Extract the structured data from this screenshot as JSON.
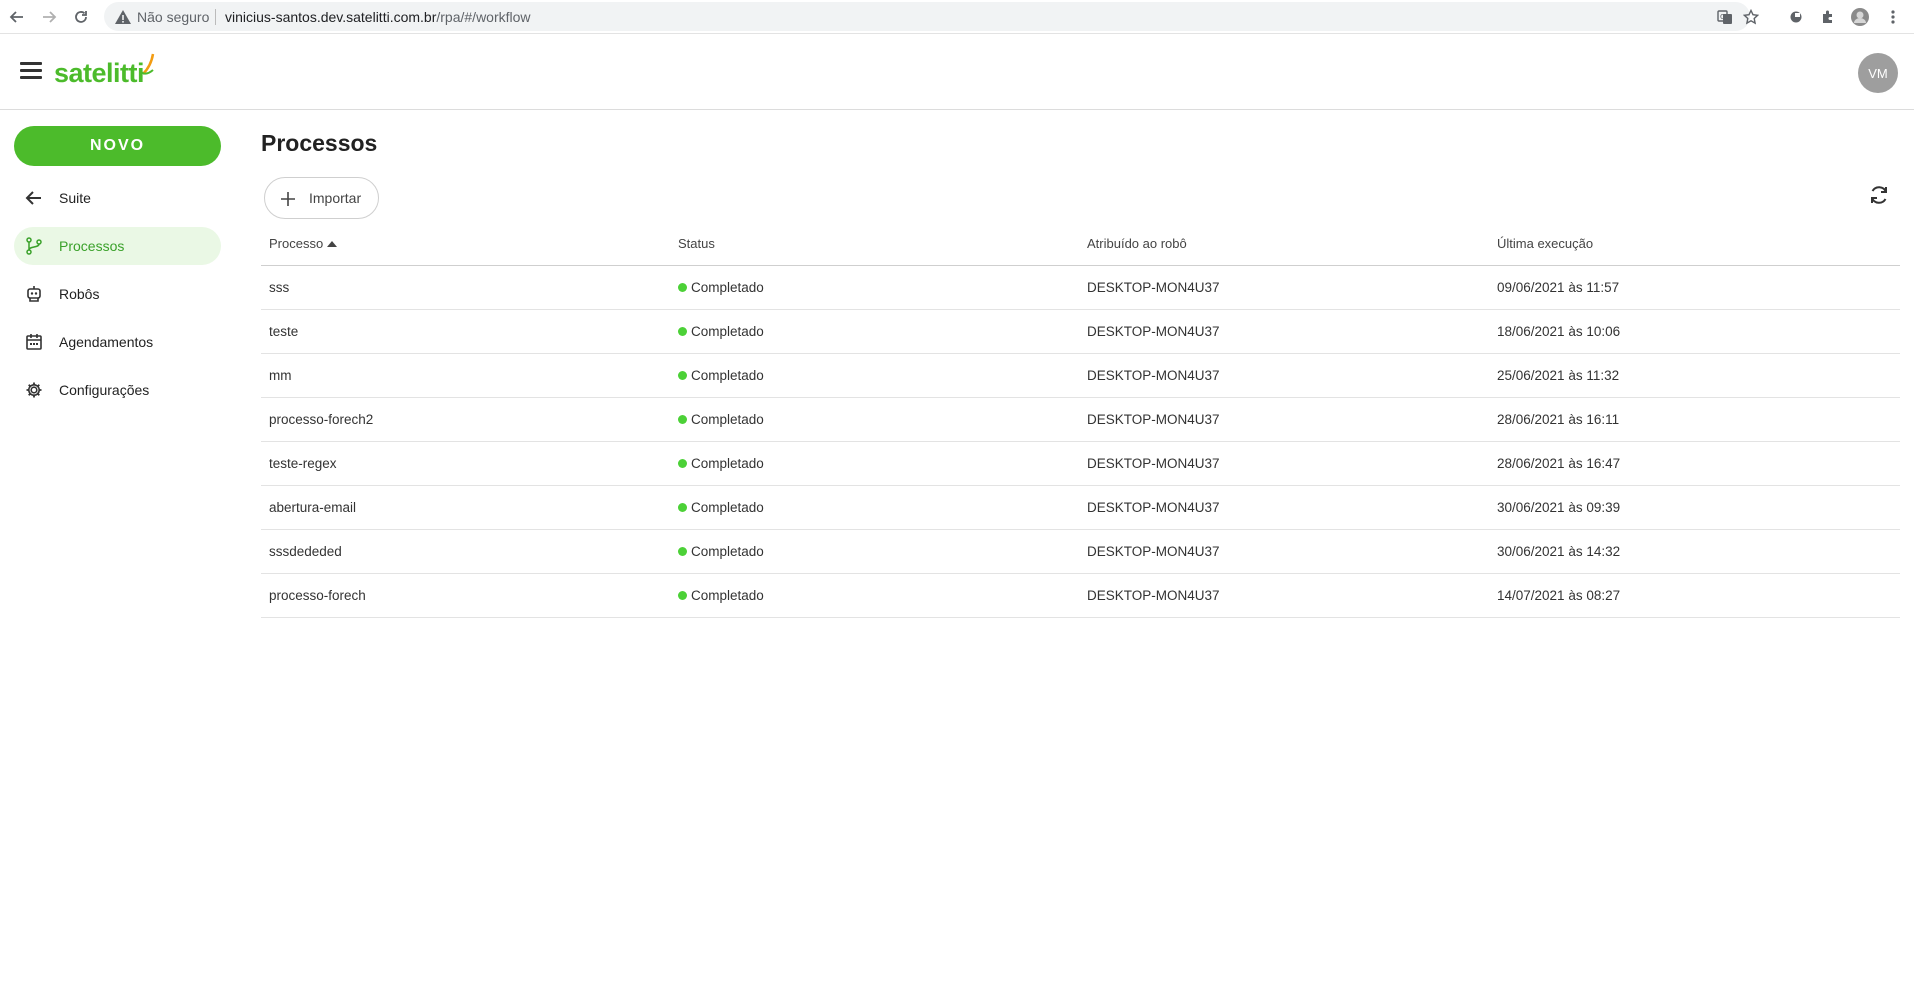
{
  "browser": {
    "security_label": "Não seguro",
    "url_host": "vinicius-santos.dev.satelitti.com.br",
    "url_path": "/rpa/#/workflow"
  },
  "header": {
    "logo_text": "satelitti",
    "avatar_initials": "VM",
    "brand_color": "#4cbb2b"
  },
  "sidebar": {
    "new_button": "NOVO",
    "items": [
      {
        "label": "Suite",
        "icon": "arrow-left-icon",
        "active": false
      },
      {
        "label": "Processos",
        "icon": "flow-branch-icon",
        "active": true
      },
      {
        "label": "Robôs",
        "icon": "robot-icon",
        "active": false
      },
      {
        "label": "Agendamentos",
        "icon": "calendar-icon",
        "active": false
      },
      {
        "label": "Configurações",
        "icon": "gear-icon",
        "active": false
      }
    ]
  },
  "main": {
    "title": "Processos",
    "import_label": "Importar",
    "table": {
      "columns": [
        "Processo",
        "Status",
        "Atribuído ao robô",
        "Última execução"
      ],
      "rows": [
        {
          "processo": "sss",
          "status": "Completado",
          "robo": "DESKTOP-MON4U37",
          "execucao": "09/06/2021 às 11:57"
        },
        {
          "processo": "teste",
          "status": "Completado",
          "robo": "DESKTOP-MON4U37",
          "execucao": "18/06/2021 às 10:06"
        },
        {
          "processo": "mm",
          "status": "Completado",
          "robo": "DESKTOP-MON4U37",
          "execucao": "25/06/2021 às 11:32"
        },
        {
          "processo": "processo-forech2",
          "status": "Completado",
          "robo": "DESKTOP-MON4U37",
          "execucao": "28/06/2021 às 16:11"
        },
        {
          "processo": "teste-regex",
          "status": "Completado",
          "robo": "DESKTOP-MON4U37",
          "execucao": "28/06/2021 às 16:47"
        },
        {
          "processo": "abertura-email",
          "status": "Completado",
          "robo": "DESKTOP-MON4U37",
          "execucao": "30/06/2021 às 09:39"
        },
        {
          "processo": "sssdededed",
          "status": "Completado",
          "robo": "DESKTOP-MON4U37",
          "execucao": "30/06/2021 às 14:32"
        },
        {
          "processo": "processo-forech",
          "status": "Completado",
          "robo": "DESKTOP-MON4U37",
          "execucao": "14/07/2021 às 08:27"
        }
      ]
    }
  }
}
